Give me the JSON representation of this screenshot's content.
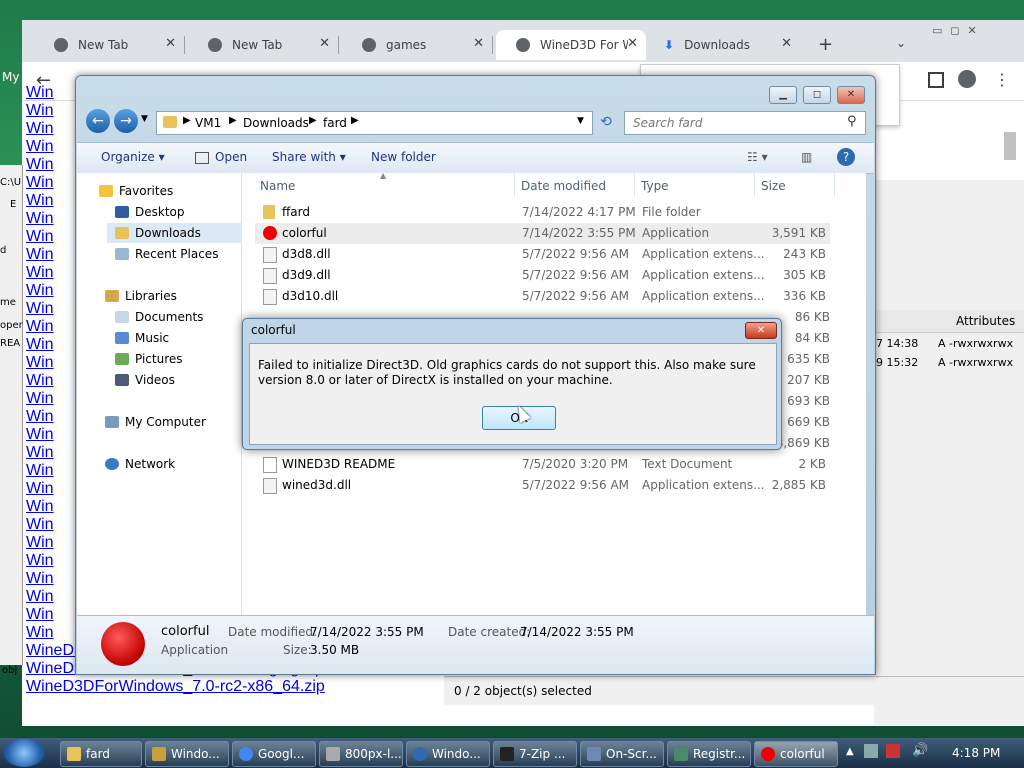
{
  "browser": {
    "tabs": [
      {
        "label": "New Tab"
      },
      {
        "label": "New Tab"
      },
      {
        "label": "games"
      },
      {
        "label": "WineD3D For W"
      },
      {
        "label": "Downloads"
      }
    ],
    "new_tab_symbol": "+",
    "links": [
      "Win",
      "Win",
      "Win",
      "Win",
      "Win",
      "Win",
      "Win",
      "Win",
      "Win",
      "Win",
      "Win",
      "Win",
      "Win",
      "Win",
      "Win",
      "Win",
      "Win",
      "Win",
      "Win",
      "Win",
      "Win",
      "Win",
      "Win",
      "Win",
      "Win",
      "Win",
      "Win",
      "Win",
      "Win",
      "Win",
      "Win",
      "WineD3DForWindows_7.0-rc2-staging-x86_64.zip",
      "WineD3DForWindows_7.0-rc2-staging.zip",
      "WineD3DForWindows_7.0-rc2-x86_64.zip"
    ]
  },
  "left_window": {
    "fragments": [
      "My",
      "C:\\U",
      "E",
      "d",
      "me",
      "oper",
      "REA",
      "obj"
    ]
  },
  "right_window": {
    "header_attributes": "Attributes",
    "rows": [
      {
        "time": "7 14:38",
        "attr": "A -rwxrwxrwx"
      },
      {
        "time": "9 15:32",
        "attr": "A -rwxrwxrwx"
      }
    ],
    "status": "0 / 2 object(s) selected"
  },
  "explorer": {
    "breadcrumb": [
      "VM1",
      "Downloads",
      "fard"
    ],
    "search_placeholder": "Search fard",
    "commands": {
      "organize": "Organize",
      "open": "Open",
      "share": "Share with",
      "new_folder": "New folder"
    },
    "nav": {
      "favorites": "Favorites",
      "desktop": "Desktop",
      "downloads": "Downloads",
      "recent": "Recent Places",
      "libraries": "Libraries",
      "documents": "Documents",
      "music": "Music",
      "pictures": "Pictures",
      "videos": "Videos",
      "computer": "My Computer",
      "network": "Network"
    },
    "columns": {
      "name": "Name",
      "date": "Date modified",
      "type": "Type",
      "size": "Size"
    },
    "files": [
      {
        "name": "ffard",
        "date": "7/14/2022 4:17 PM",
        "type": "File folder",
        "size": ""
      },
      {
        "name": "colorful",
        "date": "7/14/2022 3:55 PM",
        "type": "Application",
        "size": "3,591 KB"
      },
      {
        "name": "d3d8.dll",
        "date": "5/7/2022 9:56 AM",
        "type": "Application extens...",
        "size": "243 KB"
      },
      {
        "name": "d3d9.dll",
        "date": "5/7/2022 9:56 AM",
        "type": "Application extens...",
        "size": "305 KB"
      },
      {
        "name": "d3d10.dll",
        "date": "5/7/2022 9:56 AM",
        "type": "Application extens...",
        "size": "336 KB"
      }
    ],
    "hidden_sizes": [
      "86 KB",
      "84 KB",
      "635 KB",
      "207 KB",
      "693 KB",
      "669 KB",
      "28,869 KB"
    ],
    "files_bottom": [
      {
        "name": "WINED3D README",
        "date": "7/5/2020 3:20 PM",
        "type": "Text Document",
        "size": "2 KB"
      },
      {
        "name": "wined3d.dll",
        "date": "5/7/2022 9:56 AM",
        "type": "Application extens...",
        "size": "2,885 KB"
      }
    ],
    "details": {
      "name": "colorful",
      "kind": "Application",
      "modified_label": "Date modified:",
      "modified_value": "7/14/2022 3:55 PM",
      "created_label": "Date created:",
      "created_value": "7/14/2022 3:55 PM",
      "size_label": "Size:",
      "size_value": "3.50 MB"
    }
  },
  "dialog": {
    "title": "colorful",
    "message": "Failed to initialize Direct3D. Old graphics cards do not support this. Also make sure version 8.0 or later of DirectX is installed on your machine.",
    "ok_label": "OK"
  },
  "taskbar": {
    "items": [
      "fard",
      "Windo...",
      "Googl...",
      "800px-l...",
      "Windo...",
      "7-Zip ...",
      "On-Scr...",
      "Registr...",
      "colorful"
    ],
    "clock": "4:18 PM"
  },
  "colors": {
    "link": "#0000ee",
    "dialog_bg": "#f0f0f0",
    "accent": "#1e3287"
  }
}
